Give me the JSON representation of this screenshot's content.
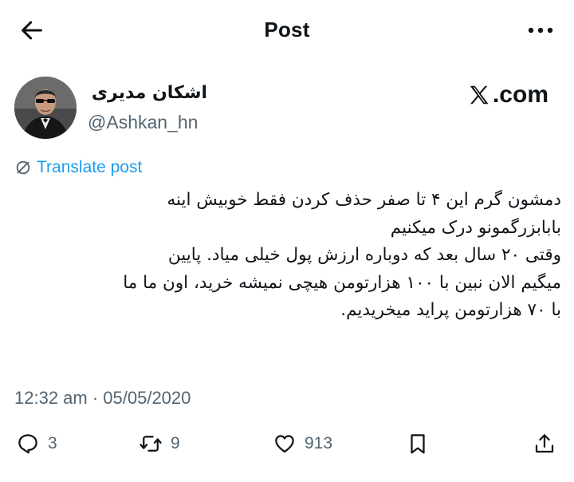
{
  "header": {
    "title": "Post"
  },
  "author": {
    "display_name": "اشکان مدیری",
    "handle": "@Ashkan_hn"
  },
  "brand": {
    "label": ".com"
  },
  "translate": {
    "label": "Translate post"
  },
  "post": {
    "lines": [
      "دمشون گرم این ۴ تا صفر حذف کردن فقط خوبیش اینه",
      "بابابزرگمونو درک میکنیم",
      "وقتی ۲۰ سال بعد که دوباره ارزش پول خیلی میاد. پایین",
      "میگیم الان نبین با ۱۰۰ هزارتومن هیچی نمیشه خرید، اون ما ما",
      "با ۷۰ هزارتومن پراید میخریدیم."
    ],
    "timestamp": "12:32 am · 05/05/2020"
  },
  "actions": {
    "replies": "3",
    "reposts": "9",
    "likes": "913"
  },
  "colors": {
    "text": "#0f1419",
    "secondary": "#536471",
    "link": "#1d9bf0",
    "background": "#ffffff"
  },
  "icons": {
    "back": "arrow-left-icon",
    "more": "more-horizontal-icon",
    "translate": "globe-slash-icon",
    "reply": "speech-bubble-icon",
    "repost": "repost-arrows-icon",
    "like": "heart-icon",
    "bookmark": "bookmark-icon",
    "share": "share-upload-icon"
  }
}
